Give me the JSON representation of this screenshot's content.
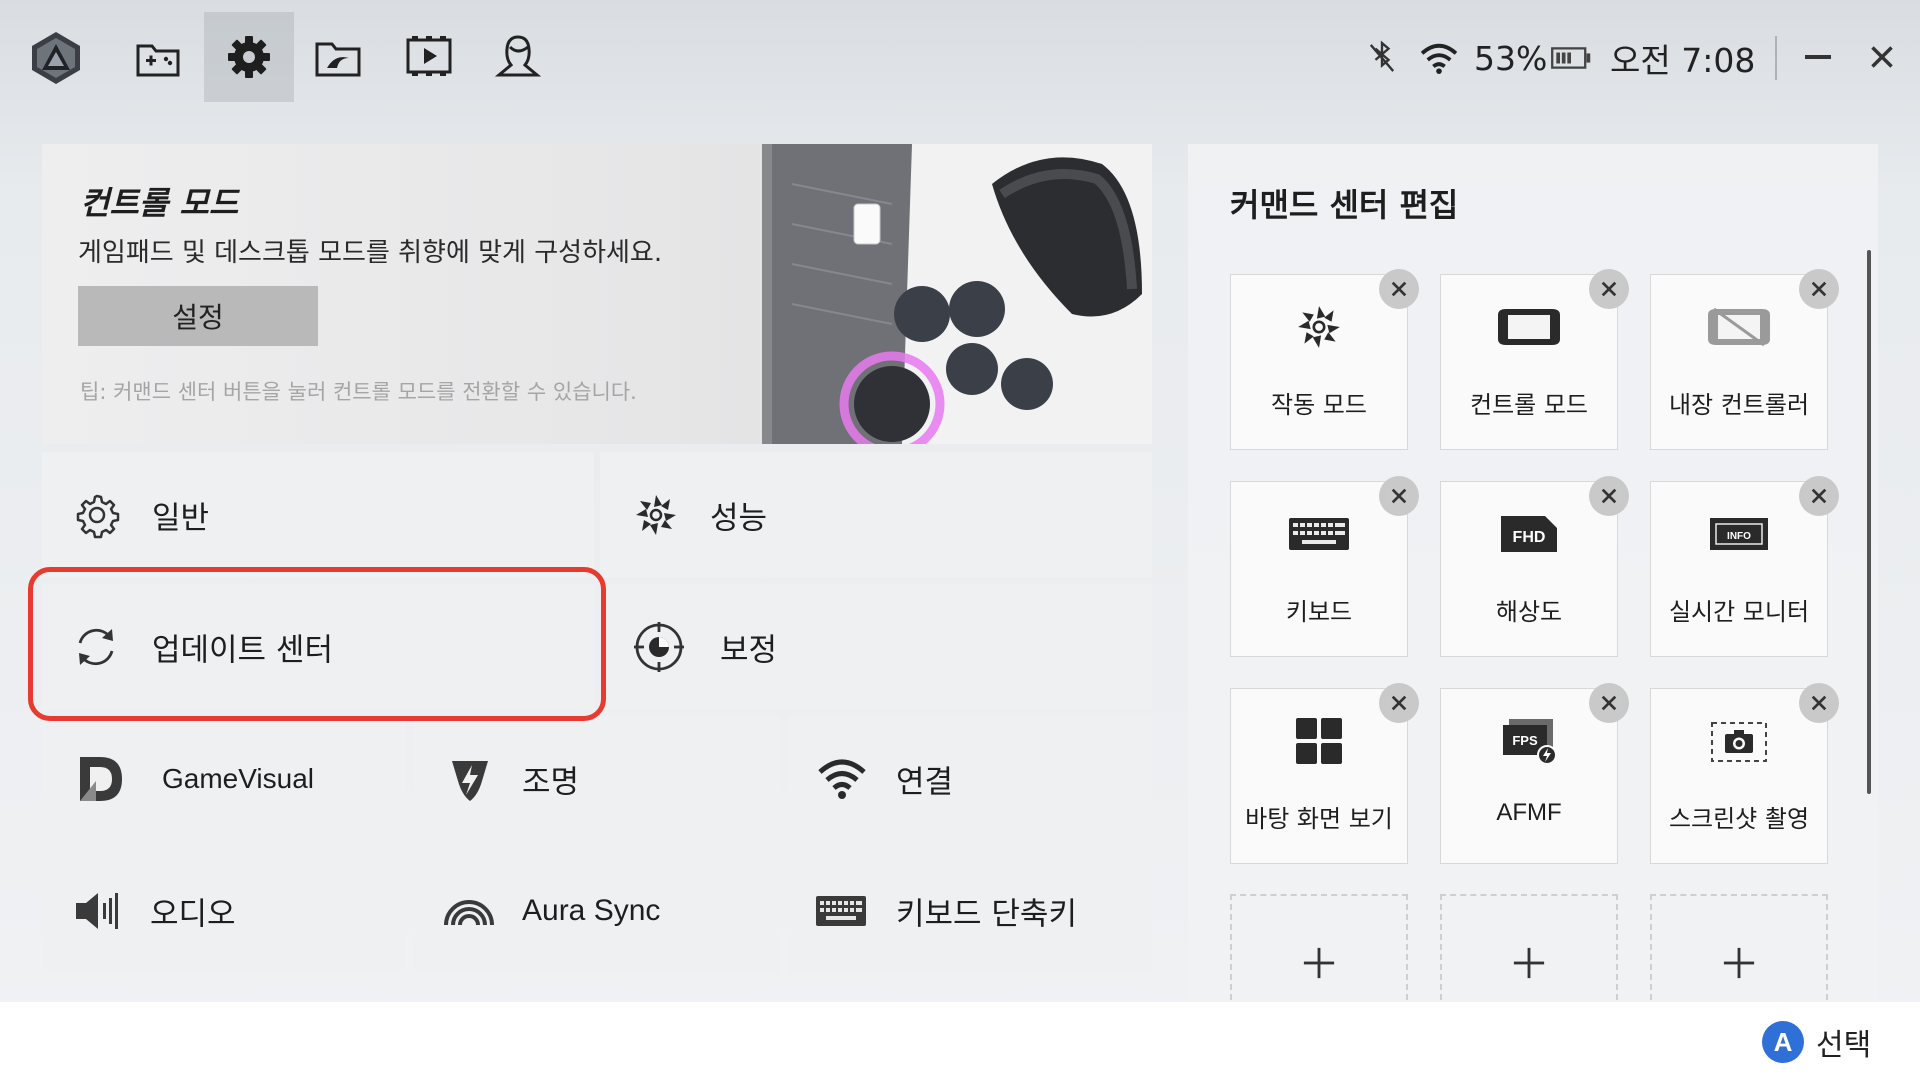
{
  "topbar": {
    "nav": [
      {
        "name": "game-library-icon"
      },
      {
        "name": "settings-icon"
      },
      {
        "name": "rog-folder-icon"
      },
      {
        "name": "media-player-icon"
      },
      {
        "name": "profile-icon"
      }
    ],
    "status": {
      "battery_percent": "53%",
      "clock": "오전 7:08"
    }
  },
  "hero": {
    "title": "컨트롤 모드",
    "description": "게임패드 및 데스크톱 모드를 취향에 맞게 구성하세요.",
    "button_label": "설정",
    "tip": "팁: 커맨드 센터 버튼을 눌러 컨트롤 모드를 전환할 수 있습니다."
  },
  "menu": {
    "general": "일반",
    "performance": "성능",
    "update_center": "업데이트 센터",
    "calibration": "보정",
    "gamevisual": "GameVisual",
    "lighting": "조명",
    "connection": "연결",
    "audio": "오디오",
    "aura_sync": "Aura Sync",
    "keyboard_shortcuts": "키보드 단축키"
  },
  "command_center": {
    "title": "커맨드 센터 편집",
    "items": [
      {
        "label": "작동 모드",
        "icon": "operating-mode-icon"
      },
      {
        "label": "컨트롤 모드",
        "icon": "control-mode-icon"
      },
      {
        "label": "내장 컨트롤러",
        "icon": "built-in-controller-off-icon"
      },
      {
        "label": "키보드",
        "icon": "keyboard-icon"
      },
      {
        "label": "해상도",
        "icon": "fhd-resolution-icon"
      },
      {
        "label": "실시간 모니터",
        "icon": "info-monitor-icon"
      },
      {
        "label": "바탕 화면 보기",
        "icon": "windows-desktop-icon"
      },
      {
        "label": "AFMF",
        "icon": "fps-afmf-icon"
      },
      {
        "label": "스크린샷 촬영",
        "icon": "screenshot-camera-icon"
      }
    ]
  },
  "footer": {
    "button_glyph": "A",
    "select_label": "선택"
  },
  "colors": {
    "focus_ring": "#e63b2e",
    "a_button": "#2f6fd8"
  }
}
